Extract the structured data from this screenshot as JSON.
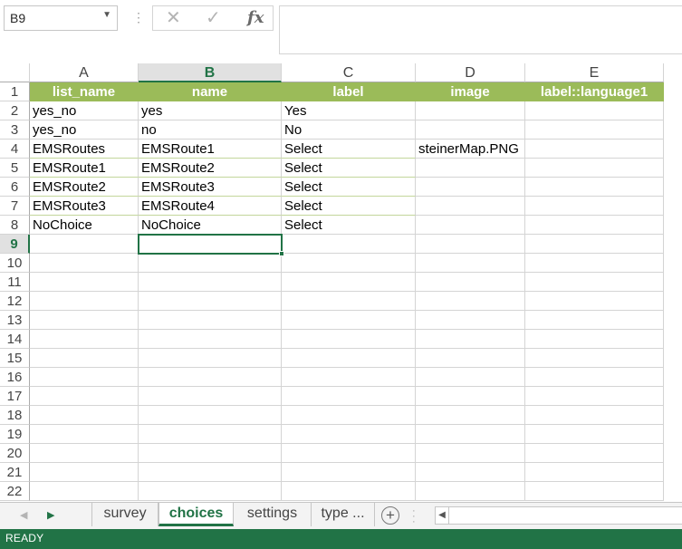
{
  "formula_bar": {
    "name_box": "B9",
    "cancel_symbol": "✕",
    "enter_symbol": "✓",
    "fx_symbol": "fx",
    "formula_value": ""
  },
  "columns": [
    "A",
    "B",
    "C",
    "D",
    "E"
  ],
  "selected_column": "B",
  "rows": [
    [
      "list_name",
      "name",
      "label",
      "image",
      "label::language1"
    ],
    [
      "yes_no",
      "yes",
      "Yes",
      "",
      ""
    ],
    [
      "yes_no",
      "no",
      "No",
      "",
      ""
    ],
    [
      "EMSRoutes",
      "EMSRoute1",
      "Select",
      "steinerMap.PNG",
      ""
    ],
    [
      "EMSRoute1",
      "EMSRoute2",
      "Select",
      "",
      ""
    ],
    [
      "EMSRoute2",
      "EMSRoute3",
      "Select",
      "",
      ""
    ],
    [
      "EMSRoute3",
      "EMSRoute4",
      "Select",
      "",
      ""
    ],
    [
      "NoChoice",
      "NoChoice",
      "Select",
      "",
      ""
    ],
    [
      "",
      "",
      "",
      "",
      ""
    ],
    [
      "",
      "",
      "",
      "",
      ""
    ],
    [
      "",
      "",
      "",
      "",
      ""
    ],
    [
      "",
      "",
      "",
      "",
      ""
    ],
    [
      "",
      "",
      "",
      "",
      ""
    ],
    [
      "",
      "",
      "",
      "",
      ""
    ],
    [
      "",
      "",
      "",
      "",
      ""
    ],
    [
      "",
      "",
      "",
      "",
      ""
    ],
    [
      "",
      "",
      "",
      "",
      ""
    ],
    [
      "",
      "",
      "",
      "",
      ""
    ],
    [
      "",
      "",
      "",
      "",
      ""
    ],
    [
      "",
      "",
      "",
      "",
      ""
    ],
    [
      "",
      "",
      "",
      "",
      ""
    ],
    [
      "",
      "",
      "",
      "",
      ""
    ]
  ],
  "row_numbers": [
    "1",
    "2",
    "3",
    "4",
    "5",
    "6",
    "7",
    "8",
    "9",
    "10",
    "11",
    "12",
    "13",
    "14",
    "15",
    "16",
    "17",
    "18",
    "19",
    "20",
    "21",
    "22"
  ],
  "active_cell": {
    "column": "B",
    "row": "9"
  },
  "colors": {
    "header_fill": "#9bbb59",
    "header_text": "#ffffff",
    "accent": "#217346"
  },
  "sheet_tabs": [
    {
      "label": "survey",
      "active": false
    },
    {
      "label": "choices",
      "active": true
    },
    {
      "label": "settings",
      "active": false
    },
    {
      "label": "type ...",
      "active": false
    }
  ],
  "sheet_nav": {
    "prev_icon": "triangle-left-icon",
    "next_icon": "triangle-right-icon",
    "add_symbol": "+"
  },
  "status": {
    "text": "READY"
  }
}
